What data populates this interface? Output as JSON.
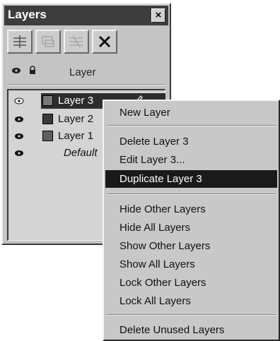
{
  "panel": {
    "title": "Layers",
    "close_label": "×",
    "toolbar": [
      {
        "icon": "new-layer-icon",
        "enabled": true
      },
      {
        "icon": "move-layer-icon",
        "enabled": false
      },
      {
        "icon": "merge-layer-icon",
        "enabled": false
      },
      {
        "icon": "delete-layer-icon",
        "enabled": true
      }
    ],
    "header": {
      "visibility_icon": "eye-icon",
      "lock_icon": "lock-icon",
      "label": "Layer"
    },
    "layers": [
      {
        "name": "Layer 3",
        "color": "#7a7a7a",
        "visible": true,
        "selected": true,
        "editing": true
      },
      {
        "name": "Layer 2",
        "color": "#3a3a3a",
        "visible": true,
        "selected": false
      },
      {
        "name": "Layer 1",
        "color": "#5e5e5e",
        "visible": true,
        "selected": false
      },
      {
        "name": "Default",
        "visible": true,
        "selected": false,
        "italic": true
      }
    ]
  },
  "context_menu": {
    "items": [
      {
        "label": "New Layer"
      },
      {
        "separator": true
      },
      {
        "label": "Delete Layer 3"
      },
      {
        "label": "Edit Layer 3..."
      },
      {
        "label": "Duplicate Layer 3",
        "highlighted": true
      },
      {
        "separator": true
      },
      {
        "label": "Hide Other Layers"
      },
      {
        "label": "Hide All Layers"
      },
      {
        "label": "Show Other Layers"
      },
      {
        "label": "Show All Layers"
      },
      {
        "label": "Lock Other Layers"
      },
      {
        "label": "Lock All Layers"
      },
      {
        "separator": true
      },
      {
        "label": "Delete Unused Layers"
      }
    ]
  },
  "colors": {
    "highlight": "#1a1a1a",
    "panel_bg": "#c4c4c4",
    "titlebar": "#3d3d3d"
  }
}
